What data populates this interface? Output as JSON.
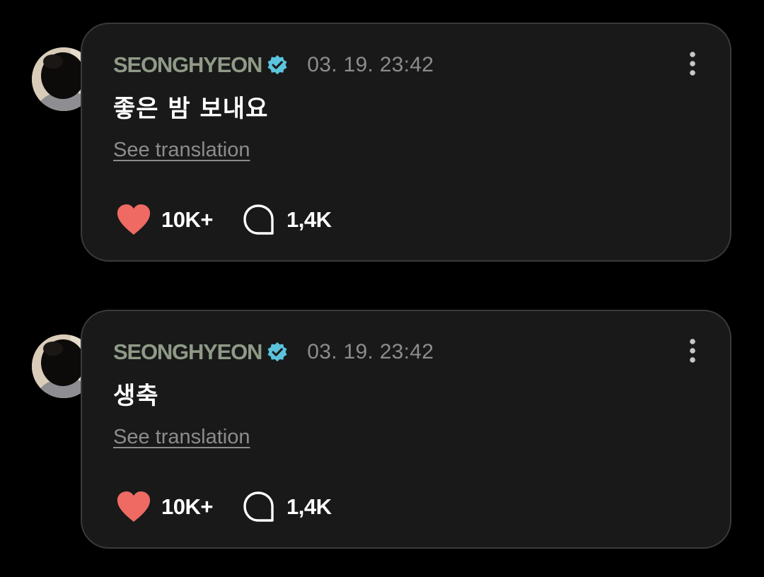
{
  "colors": {
    "background": "#000000",
    "card": "#191919",
    "card_border": "#3a3a3a",
    "username": "#8f9a87",
    "verified_badge": "#5bc4dc",
    "meta_text": "#8c8c8c",
    "like_heart": "#ee6a63",
    "text": "#ffffff"
  },
  "icons": {
    "verified": "verified-badge-icon",
    "more": "more-vertical-icon",
    "like": "heart-icon",
    "comment": "comment-bubble-icon"
  },
  "posts": [
    {
      "username": "SEONGHYEON",
      "timestamp": "03. 19. 23:42",
      "text": "좋은 밤 보내요",
      "translate_label": "See translation",
      "likes": "10K+",
      "comments": "1,4K"
    },
    {
      "username": "SEONGHYEON",
      "timestamp": "03. 19. 23:42",
      "text": "생축",
      "translate_label": "See translation",
      "likes": "10K+",
      "comments": "1,4K"
    }
  ]
}
